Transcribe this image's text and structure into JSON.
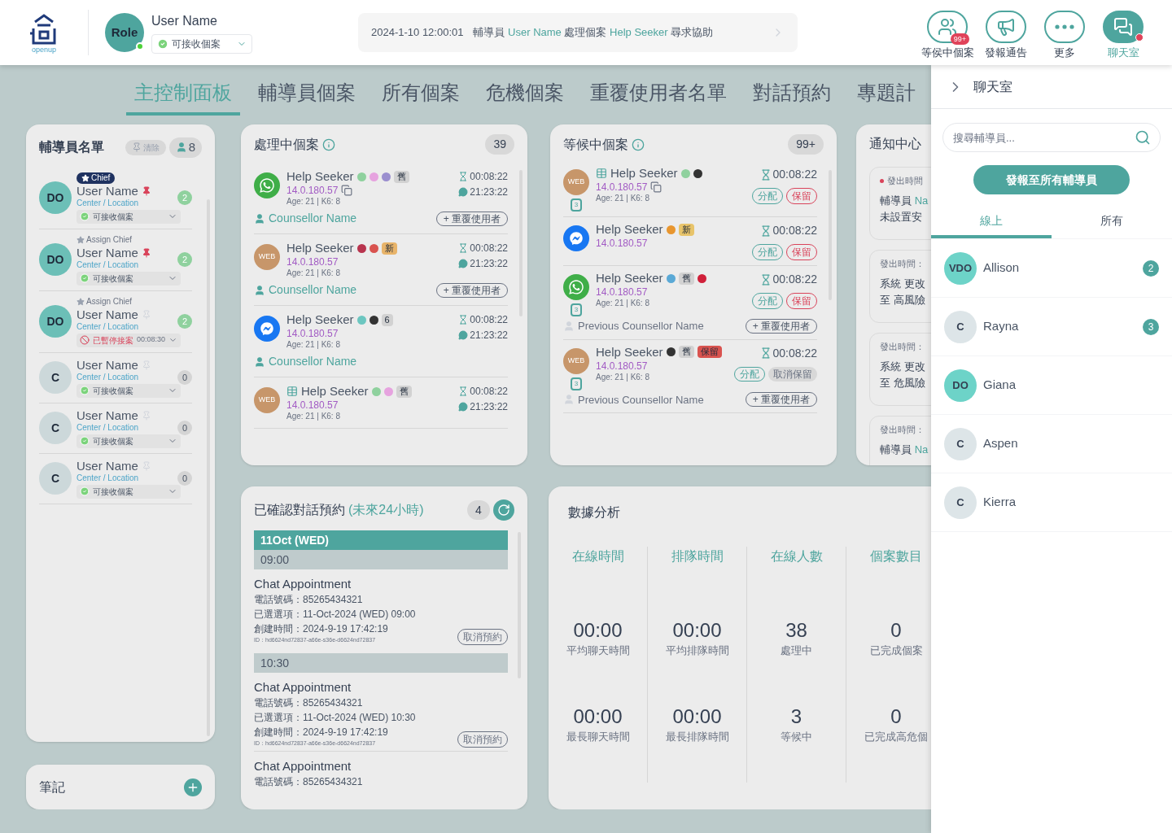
{
  "header": {
    "logo_text": "openup",
    "user": {
      "role": "Role",
      "online": true,
      "name": "User Name",
      "status": "可接收個案"
    },
    "ticker": {
      "time": "2024-1-10 12:00:01",
      "parts": [
        {
          "text": "輔導員 ",
          "highlight": false
        },
        {
          "text": "User Name",
          "highlight": true
        },
        {
          "text": " 處理個案 ",
          "highlight": false
        },
        {
          "text": "Help Seeker",
          "highlight": true
        },
        {
          "text": " 尋求協助",
          "highlight": false
        }
      ]
    },
    "toolbar": [
      {
        "kind": "queue",
        "label": "等侯中個案",
        "badge": "99+",
        "alert": false,
        "selected": false
      },
      {
        "kind": "announce",
        "label": "發報通告",
        "alert": false,
        "selected": false
      },
      {
        "kind": "more",
        "label": "更多",
        "alert": false,
        "selected": false
      },
      {
        "kind": "chat",
        "label": "聊天室",
        "alert": true,
        "selected": true
      }
    ]
  },
  "nav_tabs": [
    {
      "label": "主控制面板",
      "selected": true
    },
    {
      "label": "輔導員個案",
      "selected": false
    },
    {
      "label": "所有個案",
      "selected": false
    },
    {
      "label": "危機個案",
      "selected": false
    },
    {
      "label": "重覆使用者名單",
      "selected": false
    },
    {
      "label": "對話預約",
      "selected": false
    },
    {
      "label": "專題計",
      "selected": false
    }
  ],
  "counsellor_list": {
    "title": "輔導員名單",
    "clear_button": "清除",
    "count": "8",
    "items": [
      {
        "kind": "duty",
        "initials": "DO",
        "tag": {
          "kind": "chief",
          "text": "Chief"
        },
        "name": "User Name",
        "location": "Center / Location",
        "pinned": true,
        "status": {
          "kind": "available",
          "text": "可接收個案"
        },
        "cases": "2"
      },
      {
        "kind": "duty",
        "initials": "DO",
        "tag": {
          "kind": "assign",
          "text": "Assign Chief"
        },
        "name": "User Name",
        "location": "Center / Location",
        "pinned": true,
        "status": {
          "kind": "available",
          "text": "可接收個案"
        },
        "cases": "2"
      },
      {
        "kind": "duty",
        "initials": "DO",
        "tag": {
          "kind": "assign",
          "text": "Assign Chief"
        },
        "name": "User Name",
        "location": "Center / Location",
        "pinned": false,
        "status": {
          "kind": "paused",
          "text": "已暫停接案",
          "timer": "00:08:30"
        },
        "cases": "2"
      },
      {
        "kind": "counsellor",
        "initials": "C",
        "name": "User Name",
        "location": "Center / Location",
        "pinned": false,
        "status": {
          "kind": "available",
          "text": "可接收個案"
        },
        "cases": "0"
      },
      {
        "kind": "counsellor",
        "initials": "C",
        "name": "User Name",
        "location": "Center / Location",
        "pinned": false,
        "status": {
          "kind": "available",
          "text": "可接收個案"
        },
        "cases": "0"
      },
      {
        "kind": "counsellor",
        "initials": "C",
        "name": "User Name",
        "location": "Center / Location",
        "pinned": false,
        "status": {
          "kind": "available",
          "text": "可接收個案"
        },
        "cases": "0"
      }
    ]
  },
  "notes": {
    "title": "筆記"
  },
  "processing": {
    "title": "處理中個案",
    "count": "39",
    "cases": [
      {
        "channel": {
          "kind": "whatsapp"
        },
        "form": false,
        "name": "Help Seeker",
        "tags": [
          {
            "kind": "dot",
            "color": "#8fd19e"
          },
          {
            "kind": "dot",
            "color": "#e6a3df"
          },
          {
            "kind": "dot",
            "color": "#9b8fcf"
          },
          {
            "kind": "label",
            "text": "舊",
            "color": "#d2d2d2"
          }
        ],
        "ip": "14.0.180.57",
        "copy": true,
        "meta": "Age: 21 | K6: 8",
        "wait": "00:08:22",
        "chat": "21:23:22",
        "counsellor": "Counsellor Name",
        "repeat": "+ 重覆使用者"
      },
      {
        "channel": {
          "kind": "web",
          "label": "WEB"
        },
        "form": false,
        "name": "Help Seeker",
        "tags": [
          {
            "kind": "dot",
            "color": "#b8344e"
          },
          {
            "kind": "dot",
            "color": "#d9534f"
          },
          {
            "kind": "label",
            "text": "新",
            "color": "#e8b46a"
          }
        ],
        "ip": "14.0.180.57",
        "copy": false,
        "meta": "Age: 21 | K6: 8",
        "wait": "00:08:22",
        "chat": "21:23:22",
        "counsellor": "Counsellor Name",
        "repeat": "+ 重覆使用者"
      },
      {
        "channel": {
          "kind": "messenger"
        },
        "form": false,
        "name": "Help Seeker",
        "tags": [
          {
            "kind": "dot",
            "color": "#6cc6c0"
          },
          {
            "kind": "dot",
            "color": "#333333"
          },
          {
            "kind": "label",
            "text": "6",
            "color": "#d2d2d2"
          }
        ],
        "ip": "14.0.180.57",
        "copy": false,
        "meta": "Age: 21 | K6: 8",
        "wait": "00:08:22",
        "chat": "21:23:22",
        "counsellor": "Counsellor Name"
      },
      {
        "channel": {
          "kind": "web",
          "label": "WEB"
        },
        "form": true,
        "name": "Help Seeker",
        "tags": [
          {
            "kind": "dot",
            "color": "#8fd19e"
          },
          {
            "kind": "dot",
            "color": "#e6a3df"
          },
          {
            "kind": "label",
            "text": "舊",
            "color": "#d2d2d2"
          }
        ],
        "ip": "14.0.180.57",
        "copy": false,
        "meta": "Age: 21 | K6: 8",
        "wait": "00:08:22",
        "chat": "21:23:22"
      }
    ]
  },
  "waiting": {
    "title": "等候中個案",
    "count": "99+",
    "cases": [
      {
        "channel": {
          "kind": "web",
          "label": "WEB"
        },
        "form": true,
        "name": "Help Seeker",
        "tags": [
          {
            "kind": "dot",
            "color": "#8fd19e"
          },
          {
            "kind": "dot",
            "color": "#333333"
          }
        ],
        "ip": "14.0.180.57",
        "copy": true,
        "calendar": "3",
        "meta": "Age: 21 | K6: 8",
        "wait": "00:08:22",
        "assign": "分配",
        "held": false,
        "hold": "保留"
      },
      {
        "channel": {
          "kind": "messenger"
        },
        "form": false,
        "name": "Help Seeker",
        "tags": [
          {
            "kind": "dot",
            "color": "#e8962f"
          },
          {
            "kind": "label",
            "text": "新",
            "color": "#e8c46a"
          }
        ],
        "ip": "14.0.180.57",
        "copy": false,
        "wait": "00:08:22",
        "assign": "分配",
        "held": false,
        "hold": "保留"
      },
      {
        "channel": {
          "kind": "whatsapp"
        },
        "form": false,
        "name": "Help Seeker",
        "tags": [
          {
            "kind": "dot",
            "color": "#5aa9d6"
          },
          {
            "kind": "label",
            "text": "舊",
            "color": "#d2d2d2"
          },
          {
            "kind": "dot",
            "color": "#d0203a"
          }
        ],
        "ip": "14.0.180.57",
        "copy": false,
        "calendar": "3",
        "meta": "Age: 21 | K6: 8",
        "wait": "00:08:22",
        "assign": "分配",
        "held": false,
        "hold": "保留",
        "previous": "Previous Counsellor Name",
        "repeat": "+ 重覆使用者"
      },
      {
        "channel": {
          "kind": "web",
          "label": "WEB"
        },
        "form": false,
        "name": "Help Seeker",
        "tags": [
          {
            "kind": "dot",
            "color": "#333333"
          },
          {
            "kind": "label",
            "text": "舊",
            "color": "#d2d2d2"
          },
          {
            "kind": "label",
            "text": "保留",
            "color": "#d9534f"
          }
        ],
        "ip": "14.0.180.57",
        "copy": false,
        "calendar": "3",
        "meta": "Age: 21 | K6: 8",
        "wait": "00:08:22",
        "assign": "分配",
        "held": true,
        "hold": "取消保留",
        "previous": "Previous Counsellor Name",
        "repeat": "+ 重覆使用者"
      }
    ]
  },
  "notifications": {
    "title": "通知中心",
    "items": [
      {
        "unread": true,
        "time_label": "發出時間",
        "lines": [
          [
            {
              "text": "輔導員 ",
              "highlight": false
            },
            {
              "text": "Na",
              "highlight": true
            }
          ],
          [
            {
              "text": "未設置安",
              "highlight": false
            }
          ]
        ]
      },
      {
        "unread": false,
        "time_label": "發出時間：",
        "lines": [
          [
            {
              "text": "系統 更改",
              "highlight": false
            }
          ],
          [
            {
              "text": "至 高風險",
              "highlight": false
            }
          ]
        ]
      },
      {
        "unread": false,
        "time_label": "發出時間：",
        "lines": [
          [
            {
              "text": "系統 更改",
              "highlight": false
            }
          ],
          [
            {
              "text": "至 危風險",
              "highlight": false
            }
          ]
        ]
      },
      {
        "unread": false,
        "time_label": "發出時間：",
        "lines": [
          [
            {
              "text": "輔導員 ",
              "highlight": false
            },
            {
              "text": "Na",
              "highlight": true
            }
          ]
        ]
      }
    ]
  },
  "appointments": {
    "title": "已確認對話預約",
    "subtitle": "(未來24小時)",
    "count": "4",
    "days": [
      {
        "date": "11Oct (WED)",
        "slots": [
          {
            "time": "09:00",
            "items": [
              {
                "title": "Chat Appointment",
                "phone": "電話號碼：85265434321",
                "option": "已選選項：11-Oct-2024 (WED) 09:00",
                "created": "創建時間：2024-9-19 17:42:19",
                "id": "ID：hd6624nd72837-a66e-s36e-d6624nd72837",
                "cancel": "取消預約"
              }
            ]
          },
          {
            "time": "10:30",
            "items": [
              {
                "title": "Chat Appointment",
                "phone": "電話號碼：85265434321",
                "option": "已選選項：11-Oct-2024 (WED) 10:30",
                "created": "創建時間：2024-9-19 17:42:19",
                "id": "ID：hd6624nd72837-a66e-s36e-d6624nd72837",
                "cancel": "取消預約"
              },
              {
                "title": "Chat Appointment",
                "phone": "電話號碼：85265434321"
              }
            ]
          }
        ]
      }
    ]
  },
  "analytics": {
    "title": "數據分析",
    "columns": [
      {
        "header": "在線時間",
        "stats": [
          {
            "value": "00:00",
            "label": "平均聊天時間"
          },
          {
            "value": "00:00",
            "label": "最長聊天時間"
          }
        ]
      },
      {
        "header": "排隊時間",
        "stats": [
          {
            "value": "00:00",
            "label": "平均排隊時間"
          },
          {
            "value": "00:00",
            "label": "最長排隊時間"
          }
        ]
      },
      {
        "header": "在線人數",
        "stats": [
          {
            "value": "38",
            "label": "處理中"
          },
          {
            "value": "3",
            "label": "等候中"
          }
        ]
      },
      {
        "header": "個案數目",
        "stats": [
          {
            "value": "0",
            "label": "已完成個案"
          },
          {
            "value": "0",
            "label": "已完成高危個"
          }
        ]
      }
    ]
  },
  "chat_drawer": {
    "title": "聊天室",
    "search_placeholder": "搜尋輔導員...",
    "broadcast_button": "發報至所有輔導員",
    "tabs": [
      {
        "label": "線上",
        "selected": true
      },
      {
        "label": "所有",
        "selected": false
      }
    ],
    "members": [
      {
        "kind": "duty",
        "initials": "VDO",
        "name": "Allison",
        "unread": "2"
      },
      {
        "kind": "counsellor",
        "initials": "C",
        "name": "Rayna",
        "unread": "3"
      },
      {
        "kind": "duty",
        "initials": "DO",
        "name": "Giana"
      },
      {
        "kind": "counsellor",
        "initials": "C",
        "name": "Aspen"
      },
      {
        "kind": "counsellor",
        "initials": "C",
        "name": "Kierra"
      }
    ]
  }
}
